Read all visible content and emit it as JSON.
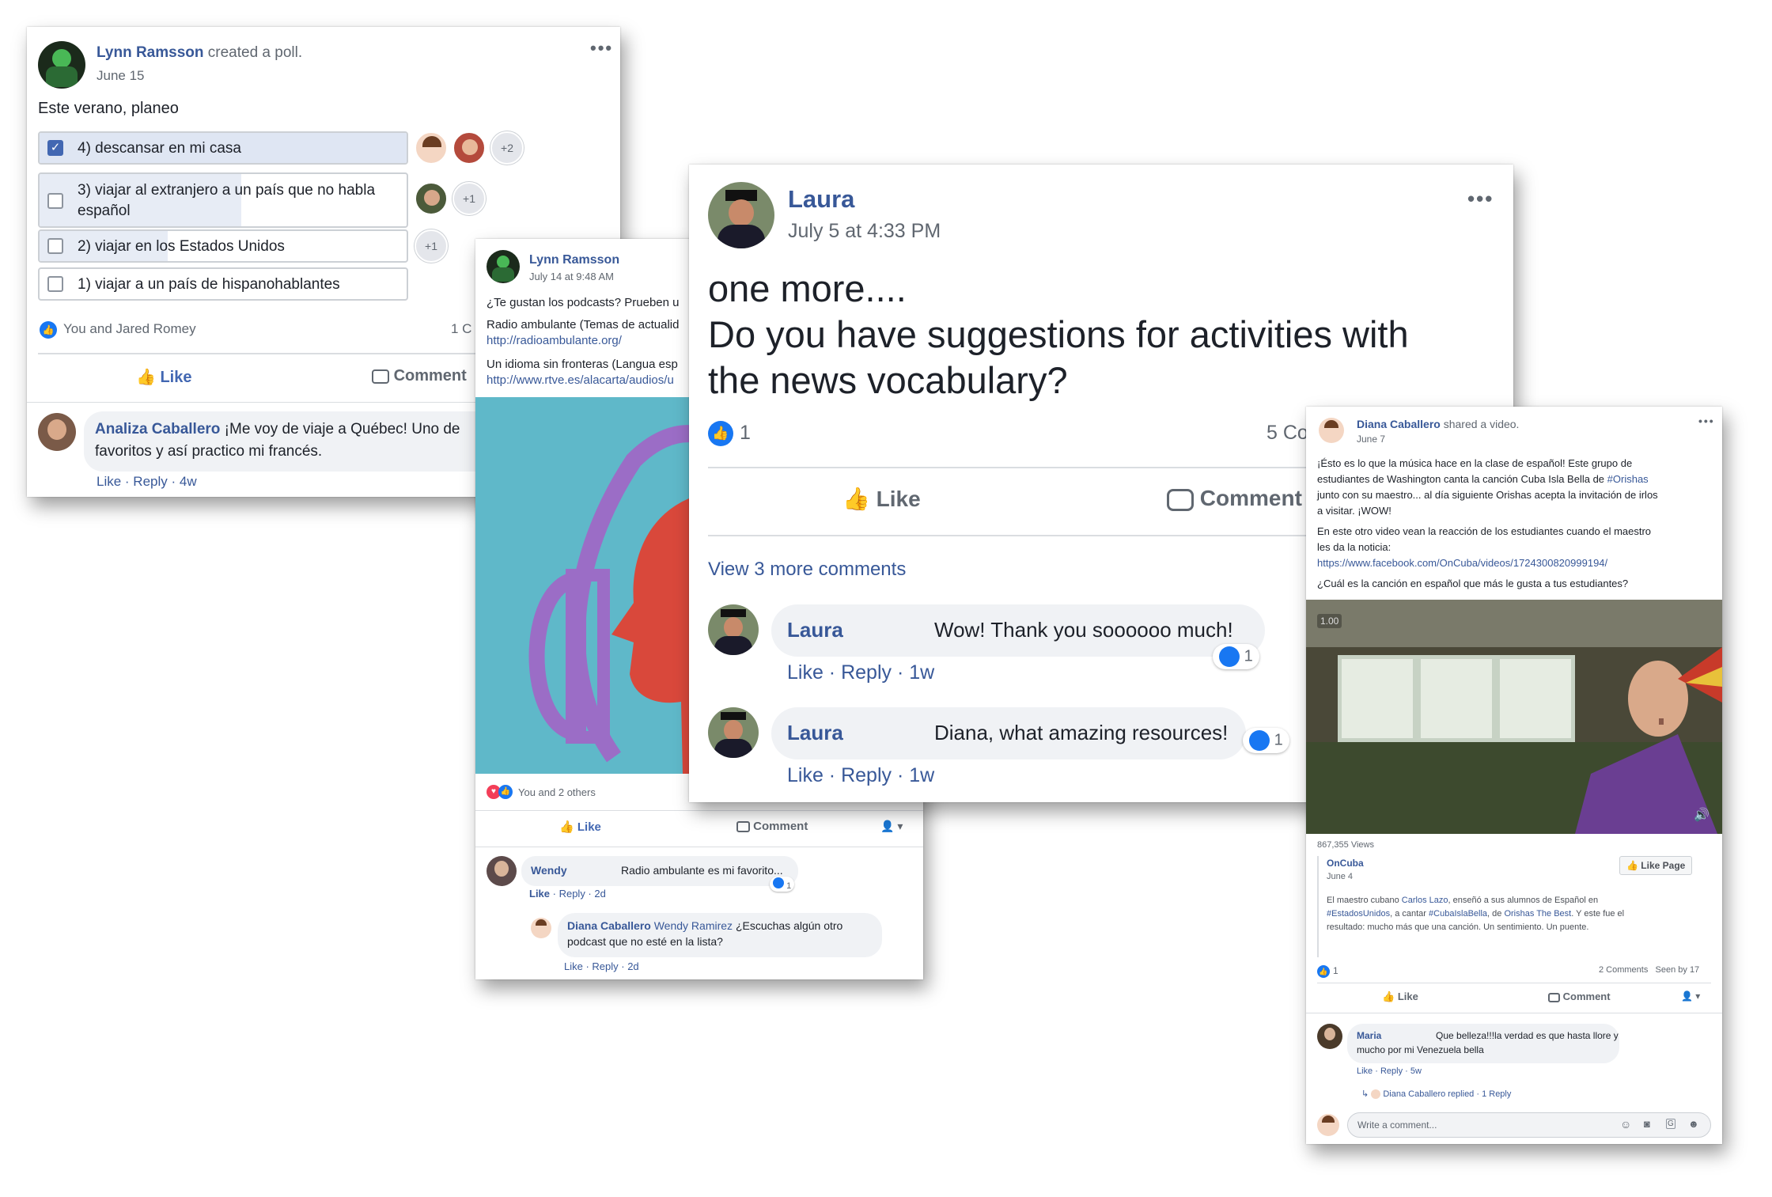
{
  "poll_post": {
    "author": "Lynn Ramsson",
    "action": "created a poll.",
    "date": "June 15",
    "question": "Este verano, planeo",
    "options": [
      {
        "label": "4) descansar en mi casa",
        "checked": true,
        "extra_votes": "+2"
      },
      {
        "label": "3) viajar al extranjero a un país que no habla español",
        "checked": false,
        "extra_votes": "+1"
      },
      {
        "label": "2) viajar en los Estados Unidos",
        "checked": false,
        "extra_votes": "+1"
      },
      {
        "label": "1) viajar a un país de hispanohablantes",
        "checked": false,
        "extra_votes": ""
      }
    ],
    "reactions": "You and Jared Romey",
    "comment_count_partial": "1 C",
    "like_label": "Like",
    "comment_label": "Comment",
    "comment": {
      "author": "Analiza Caballero",
      "text_line1": "¡Me voy de viaje a Québec! Uno de",
      "text_line2": "favoritos y así practico mi francés.",
      "meta": "Like · Reply · 4w"
    }
  },
  "podcast_post": {
    "author": "Lynn Ramsson",
    "date": "July 14 at 9:48 AM",
    "line1": "¿Te gustan los podcasts? Prueben u",
    "line2": "Radio ambulante (Temas de actualid",
    "link1": "http://radioambulante.org/",
    "line3": "Un idioma sin fronteras (Langua esp",
    "link2": "http://www.rtve.es/alacarta/audios/u",
    "reactions": "You and 2 others",
    "like_label": "Like",
    "comment_label": "Comment",
    "comment1": {
      "author": "Wendy",
      "text": "Radio ambulante es mi favorito...",
      "meta_like": "Like",
      "meta_rest": "· Reply · 2d",
      "likes": "1"
    },
    "comment2": {
      "author": "Diana Caballero",
      "mention": "Wendy Ramirez",
      "text_line1": "¿Escuchas algún otro",
      "text_line2": "podcast que no esté en la lista?",
      "meta": "Like · Reply · 2d"
    }
  },
  "laura_post": {
    "author": "Laura",
    "date": "July 5 at 4:33 PM",
    "text_line1": "one more....",
    "text_line2": "Do you have suggestions for activities with",
    "text_line3": "the news vocabulary?",
    "like_count": "1",
    "comments_partial": "5 Co",
    "like_label": "Like",
    "comment_label": "Comment",
    "view_more": "View 3 more comments",
    "comments": [
      {
        "author": "Laura",
        "text": "Wow! Thank you soooooo much!",
        "meta": "Like · Reply · 1w",
        "likes": "1"
      },
      {
        "author": "Laura",
        "text": "Diana, what amazing resources!",
        "meta": "Like · Reply · 1w",
        "likes": "1"
      }
    ]
  },
  "video_post": {
    "author": "Diana Caballero",
    "action": "shared a video.",
    "date": "June 7",
    "p1_line1": "¡Ésto es lo que la música hace en la clase de español! Este grupo de",
    "p1_line2_a": "estudiantes de Washington canta la canción Cuba Isla Bella de",
    "p1_hashtag": "#Orishas",
    "p1_line3": "junto con su maestro... al día siguiente Orishas acepta la invitación de irlos",
    "p1_line4": "a visitar. ¡WOW!",
    "p2_line1": "En este otro video vean la reacción de los estudiantes cuando el maestro",
    "p2_line2": "les da la noticia:",
    "p2_link": "https://www.facebook.com/OnCuba/videos/1724300820999194/",
    "p3": "¿Cuál es la canción en español que más le gusta a tus estudiantes?",
    "video_timestamp": "1.00",
    "views": "867,355 Views",
    "page_name": "OnCuba",
    "page_date": "June 4",
    "like_page": "Like Page",
    "desc_line1_a": "El maestro cubano",
    "desc_name": "Carlos Lazo",
    "desc_line1_b": ", enseñó a sus alumnos de Español en",
    "desc_line2_tag1": "#EstadosUnidos",
    "desc_line2_a": ", a cantar",
    "desc_line2_tag2": "#CubaIslaBella",
    "desc_line2_b": ", de",
    "desc_line2_name": "Orishas The Best",
    "desc_line2_c": ". Y este fue el",
    "desc_line3": "resultado: mucho más que una canción. Un sentimiento. Un puente.",
    "like_count": "1",
    "comments_seen": "2 Comments   Seen by 17",
    "like_label": "Like",
    "comment_label": "Comment",
    "comment": {
      "author": "Maria",
      "text_line1": "Que belleza!!!la verdad es que hasta llore y",
      "text_line2": "mucho por mi Venezuela bella",
      "meta": "Like · Reply · 5w"
    },
    "reply_summary": "Diana Caballero replied · 1 Reply",
    "write_placeholder": "Write a comment..."
  },
  "colors": {
    "link_blue": "#385898",
    "fb_blue": "#1877f2",
    "video_teal": "#5fb8c9",
    "purple": "#9b6dc6",
    "red_orange": "#d9483b"
  }
}
